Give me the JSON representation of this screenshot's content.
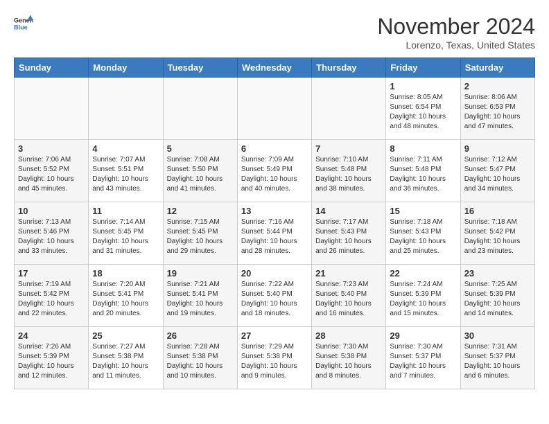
{
  "header": {
    "logo_line1": "General",
    "logo_line2": "Blue",
    "month": "November 2024",
    "location": "Lorenzo, Texas, United States"
  },
  "weekdays": [
    "Sunday",
    "Monday",
    "Tuesday",
    "Wednesday",
    "Thursday",
    "Friday",
    "Saturday"
  ],
  "weeks": [
    [
      {
        "day": "",
        "info": ""
      },
      {
        "day": "",
        "info": ""
      },
      {
        "day": "",
        "info": ""
      },
      {
        "day": "",
        "info": ""
      },
      {
        "day": "",
        "info": ""
      },
      {
        "day": "1",
        "info": "Sunrise: 8:05 AM\nSunset: 6:54 PM\nDaylight: 10 hours and 48 minutes."
      },
      {
        "day": "2",
        "info": "Sunrise: 8:06 AM\nSunset: 6:53 PM\nDaylight: 10 hours and 47 minutes."
      }
    ],
    [
      {
        "day": "3",
        "info": "Sunrise: 7:06 AM\nSunset: 5:52 PM\nDaylight: 10 hours and 45 minutes."
      },
      {
        "day": "4",
        "info": "Sunrise: 7:07 AM\nSunset: 5:51 PM\nDaylight: 10 hours and 43 minutes."
      },
      {
        "day": "5",
        "info": "Sunrise: 7:08 AM\nSunset: 5:50 PM\nDaylight: 10 hours and 41 minutes."
      },
      {
        "day": "6",
        "info": "Sunrise: 7:09 AM\nSunset: 5:49 PM\nDaylight: 10 hours and 40 minutes."
      },
      {
        "day": "7",
        "info": "Sunrise: 7:10 AM\nSunset: 5:48 PM\nDaylight: 10 hours and 38 minutes."
      },
      {
        "day": "8",
        "info": "Sunrise: 7:11 AM\nSunset: 5:48 PM\nDaylight: 10 hours and 36 minutes."
      },
      {
        "day": "9",
        "info": "Sunrise: 7:12 AM\nSunset: 5:47 PM\nDaylight: 10 hours and 34 minutes."
      }
    ],
    [
      {
        "day": "10",
        "info": "Sunrise: 7:13 AM\nSunset: 5:46 PM\nDaylight: 10 hours and 33 minutes."
      },
      {
        "day": "11",
        "info": "Sunrise: 7:14 AM\nSunset: 5:45 PM\nDaylight: 10 hours and 31 minutes."
      },
      {
        "day": "12",
        "info": "Sunrise: 7:15 AM\nSunset: 5:45 PM\nDaylight: 10 hours and 29 minutes."
      },
      {
        "day": "13",
        "info": "Sunrise: 7:16 AM\nSunset: 5:44 PM\nDaylight: 10 hours and 28 minutes."
      },
      {
        "day": "14",
        "info": "Sunrise: 7:17 AM\nSunset: 5:43 PM\nDaylight: 10 hours and 26 minutes."
      },
      {
        "day": "15",
        "info": "Sunrise: 7:18 AM\nSunset: 5:43 PM\nDaylight: 10 hours and 25 minutes."
      },
      {
        "day": "16",
        "info": "Sunrise: 7:18 AM\nSunset: 5:42 PM\nDaylight: 10 hours and 23 minutes."
      }
    ],
    [
      {
        "day": "17",
        "info": "Sunrise: 7:19 AM\nSunset: 5:42 PM\nDaylight: 10 hours and 22 minutes."
      },
      {
        "day": "18",
        "info": "Sunrise: 7:20 AM\nSunset: 5:41 PM\nDaylight: 10 hours and 20 minutes."
      },
      {
        "day": "19",
        "info": "Sunrise: 7:21 AM\nSunset: 5:41 PM\nDaylight: 10 hours and 19 minutes."
      },
      {
        "day": "20",
        "info": "Sunrise: 7:22 AM\nSunset: 5:40 PM\nDaylight: 10 hours and 18 minutes."
      },
      {
        "day": "21",
        "info": "Sunrise: 7:23 AM\nSunset: 5:40 PM\nDaylight: 10 hours and 16 minutes."
      },
      {
        "day": "22",
        "info": "Sunrise: 7:24 AM\nSunset: 5:39 PM\nDaylight: 10 hours and 15 minutes."
      },
      {
        "day": "23",
        "info": "Sunrise: 7:25 AM\nSunset: 5:39 PM\nDaylight: 10 hours and 14 minutes."
      }
    ],
    [
      {
        "day": "24",
        "info": "Sunrise: 7:26 AM\nSunset: 5:39 PM\nDaylight: 10 hours and 12 minutes."
      },
      {
        "day": "25",
        "info": "Sunrise: 7:27 AM\nSunset: 5:38 PM\nDaylight: 10 hours and 11 minutes."
      },
      {
        "day": "26",
        "info": "Sunrise: 7:28 AM\nSunset: 5:38 PM\nDaylight: 10 hours and 10 minutes."
      },
      {
        "day": "27",
        "info": "Sunrise: 7:29 AM\nSunset: 5:38 PM\nDaylight: 10 hours and 9 minutes."
      },
      {
        "day": "28",
        "info": "Sunrise: 7:30 AM\nSunset: 5:38 PM\nDaylight: 10 hours and 8 minutes."
      },
      {
        "day": "29",
        "info": "Sunrise: 7:30 AM\nSunset: 5:37 PM\nDaylight: 10 hours and 7 minutes."
      },
      {
        "day": "30",
        "info": "Sunrise: 7:31 AM\nSunset: 5:37 PM\nDaylight: 10 hours and 6 minutes."
      }
    ]
  ],
  "colors": {
    "header_bg": "#3a7abf",
    "header_text": "#ffffff",
    "odd_col_bg": "#f5f5f5",
    "even_col_bg": "#ffffff",
    "border": "#cccccc"
  }
}
